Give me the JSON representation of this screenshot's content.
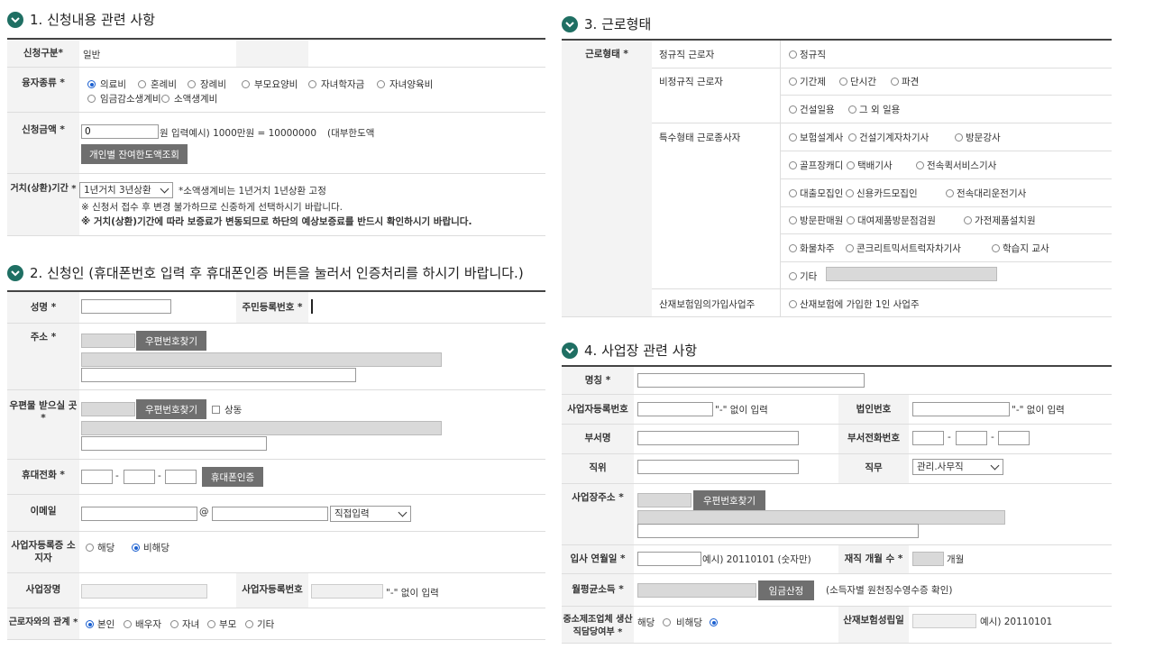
{
  "s1": {
    "title": "1. 신청내용 관련 사항",
    "type_label": "신청구분*",
    "type_value": "일반",
    "loan_label": "융자종류 *",
    "loan_opts": [
      "의료비",
      "혼례비",
      "장례비",
      "부모요양비",
      "자녀학자금",
      "자녀양육비",
      "임금감소생계비",
      "소액생계비"
    ],
    "amount_label": "신청금액 *",
    "amount_value": "0",
    "amount_hint": "원 입력예시) 1000만원 = 10000000",
    "amount_hint2": "(대부한도액",
    "limit_btn": "개인별 잔여한도액조회",
    "period_label": "거치(상환)기간 *",
    "period_select": "1년거치 3년상환",
    "period_note1": "*소액생계비는 1년거치 1년상환 고정",
    "period_note2": "※ 신청서 접수 후 변경 불가하므로 신중하게 선택하시기 바랍니다.",
    "period_note3": "※ 거치(상환)기간에 따라 보증료가 변동되므로 하단의 예상보증료를 반드시 확인하시기 바랍니다."
  },
  "s2": {
    "title": "2. 신청인 (휴대폰번호 입력 후 휴대폰인증 버튼을 눌러서 인증처리를 하시기 바랍니다.)",
    "name_label": "성명 *",
    "rrn_label": "주민등록번호 *",
    "addr_label": "주소 *",
    "zip_btn": "우편번호찾기",
    "mail_label": "우편물 받으실 곳 *",
    "same_label": "상동",
    "phone_label": "휴대전화 *",
    "phone_btn": "휴대폰인증",
    "email_label": "이메일",
    "email_at": "@",
    "email_select": "직접입력",
    "bizowner_label": "사업자등록증 소지자",
    "yes": "해당",
    "no": "비해당",
    "bizname_label": "사업장명",
    "bizno_label": "사업자등록번호",
    "bizno_hint": "\"-\" 없이 입력",
    "rel_label": "근로자와의 관계 *",
    "rel_opts": [
      "본인",
      "배우자",
      "자녀",
      "부모",
      "기타"
    ]
  },
  "s3": {
    "title": "3. 근로형태",
    "label": "근로형태 *",
    "regular": "정규직 근로자",
    "regular_opt": "정규직",
    "irregular": "비정규직 근로자",
    "irregular_opts1": [
      "기간제",
      "단시간",
      "파견"
    ],
    "irregular_opts2": [
      "건설일용",
      "그 외 일용"
    ],
    "special": "특수형태 근로종사자",
    "special_rows": [
      [
        "보험설계사",
        "건설기계자차기사",
        "방문강사"
      ],
      [
        "골프장캐디",
        "택배기사",
        "전속퀵서비스기사"
      ],
      [
        "대출모집인",
        "신용카드모집인",
        "전속대리운전기사"
      ],
      [
        "방문판매원",
        "대여제품방문점검원",
        "가전제품설치원"
      ],
      [
        "화물차주",
        "콘크리트믹서트럭자차기사",
        "학습지 교사"
      ]
    ],
    "other": "기타",
    "insured": "산재보험임의가입사업주",
    "insured_opt": "산재보험에 가입한 1인 사업주"
  },
  "s4": {
    "title": "4. 사업장 관련 사항",
    "name_label": "명칭 *",
    "bizno_label": "사업자등록번호",
    "hint": "\"-\" 없이 입력",
    "corp_label": "법인번호",
    "dept_label": "부서명",
    "deptphone_label": "부서전화번호",
    "pos_label": "직위",
    "duty_label": "직무",
    "duty_select": "관리.사무직",
    "addr_label": "사업장주소 *",
    "zip_btn": "우편번호찾기",
    "join_label": "입사 연월일 *",
    "join_hint": "예시) 20110101 (숫자만)",
    "months_label": "재직 개월 수 *",
    "months_unit": "개월",
    "wage_label": "월평균소득 *",
    "wage_btn": "임금산정",
    "wage_hint": "(소득자별 원천징수영수증 확인)",
    "sme_label": "중소제조업체 생산직담당여부 *",
    "yes": "해당",
    "no": "비해당",
    "ins_label": "산재보험성립일",
    "ins_hint": "예시) 20110101"
  }
}
